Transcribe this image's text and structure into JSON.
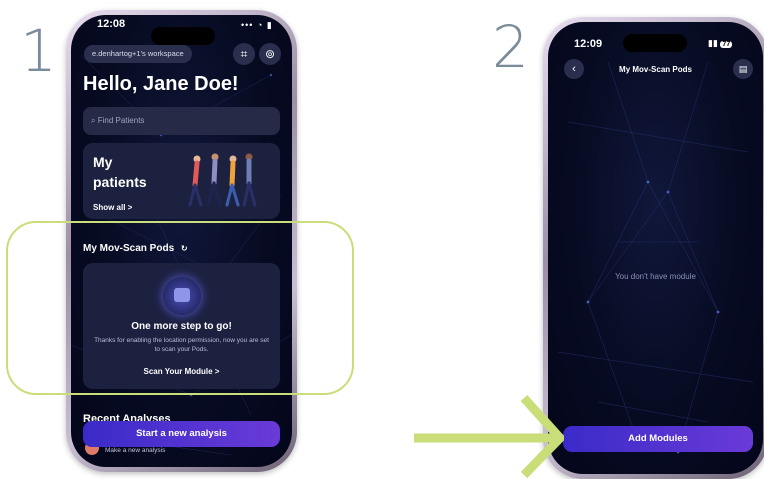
{
  "steps": {
    "one": "1",
    "two": "2"
  },
  "phone1": {
    "time": "12:08",
    "status_icons": "••• ◔ ▮",
    "workspace_label": "e.denhartog+1's workspace",
    "greeting": "Hello, Jane Doe!",
    "search_placeholder": "Find Patients",
    "patients_card": {
      "title_line1": "My",
      "title_line2": "patients",
      "show_all": "Show all >"
    },
    "pods_section_title": "My Mov-Scan Pods",
    "pods_card": {
      "heading": "One more step to go!",
      "message": "Thanks for enabling the location permission, now you are set to scan your Pods.",
      "cta": "Scan Your Module >"
    },
    "recent_title": "Recent Analyses",
    "recent_item": "Make a new analysis",
    "start_button": "Start a new analysis"
  },
  "phone2": {
    "time": "12:09",
    "battery": "77",
    "title": "My Mov-Scan Pods",
    "empty_message": "You don't have module",
    "add_button": "Add Modules"
  },
  "icons": {
    "scan": "scan-qr-icon",
    "settings": "settings-icon",
    "search": "search-icon",
    "back": "chevron-left-icon",
    "trash": "trash-icon",
    "refresh": "refresh-icon"
  },
  "colors": {
    "highlight": "#c9de78",
    "arrow": "#c9de78",
    "button_gradient_start": "#3a2bc8",
    "button_gradient_end": "#6a3ad8",
    "screen_bg": "#070b22"
  }
}
